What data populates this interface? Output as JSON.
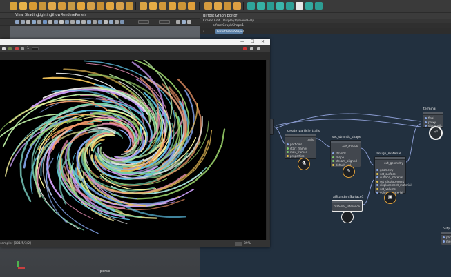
{
  "maya_viewport": {
    "menu": [
      "View",
      "Shading",
      "Lighting",
      "Show",
      "Renderer",
      "Panels"
    ],
    "camera_label": "persp"
  },
  "graph_editor": {
    "window_title": "Bifrost Graph Editor",
    "menus": [
      "Create",
      "Edit",
      "Display",
      "Options",
      "Help"
    ],
    "tab_name": "bifrostGraphShape1",
    "breadcrumb": "bifrostGraphShape1",
    "nodes": {
      "create_particle_trails": {
        "title": "create_particle_trails",
        "ports": [
          "particles",
          "start_frames",
          "max_frames",
          "properties"
        ],
        "output": "trails"
      },
      "set_strands_shape": {
        "title": "set_strands_shape",
        "ports": [
          "strands",
          "shape",
          "stream_aligned",
          "default_val"
        ],
        "output": "out_strands"
      },
      "assign_material": {
        "title": "assign_material",
        "ports": [
          "geometry",
          "set_surface",
          "surface_material",
          "set_displacement",
          "displacement_material",
          "set_volume",
          "volume_material"
        ],
        "output": "out_geometry"
      },
      "aiStandardSurface": {
        "title": "aiStandardSurface1",
        "output": "material_reference"
      },
      "terminal": {
        "title": "terminal",
        "ports": [
          "final",
          "proxy",
          "diagnostic"
        ]
      },
      "output": {
        "title": "output",
        "ports": [
          "particles",
          "mesh"
        ]
      }
    }
  },
  "render_window": {
    "frame_field": "1",
    "status_text": "sampler [001/5/3/2]",
    "zoom": "39%"
  },
  "colors": {
    "graph_bg": "#22303f",
    "node_body": "#42474e",
    "accent_orange": "#e3a23a",
    "wire": "#8a9bd0",
    "port_green": "#7ecb6e",
    "port_yellow": "#e0c24a",
    "port_blue": "#8aa8e6"
  }
}
